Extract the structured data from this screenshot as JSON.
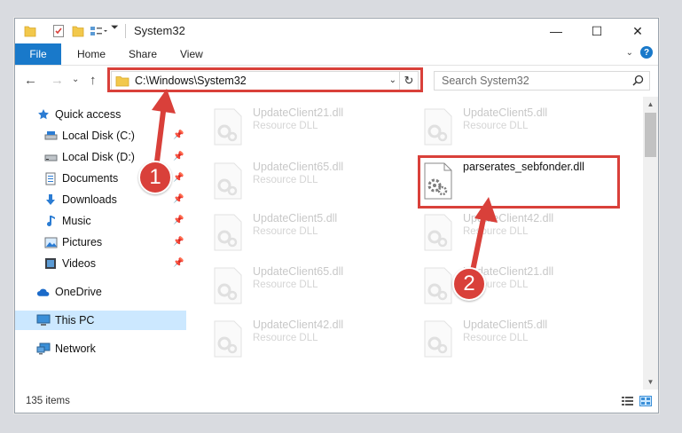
{
  "window": {
    "title": "System32",
    "minimize_glyph": "—",
    "maximize_glyph": "☐",
    "close_glyph": "✕"
  },
  "ribbon": {
    "tabs": [
      "File",
      "Home",
      "Share",
      "View"
    ],
    "expand_glyph": "⌄",
    "help_glyph": "?"
  },
  "nav": {
    "back_glyph": "←",
    "forward_glyph": "→",
    "recent_glyph": "⌄",
    "up_glyph": "↑",
    "address": "C:\\Windows\\System32",
    "address_dropdown_glyph": "⌄",
    "refresh_glyph": "↻",
    "search_placeholder": "Search System32"
  },
  "sidebar": {
    "items": [
      {
        "label": "Quick access",
        "icon": "star-icon",
        "pinned": false
      },
      {
        "label": "Local Disk (C:)",
        "icon": "drive-icon",
        "pinned": true
      },
      {
        "label": "Local Disk (D:)",
        "icon": "drive-icon",
        "pinned": true
      },
      {
        "label": "Documents",
        "icon": "documents-icon",
        "pinned": true
      },
      {
        "label": "Downloads",
        "icon": "download-icon",
        "pinned": true
      },
      {
        "label": "Music",
        "icon": "music-icon",
        "pinned": true
      },
      {
        "label": "Pictures",
        "icon": "pictures-icon",
        "pinned": true
      },
      {
        "label": "Videos",
        "icon": "videos-icon",
        "pinned": true
      },
      {
        "label": "OneDrive",
        "icon": "cloud-icon",
        "pinned": false
      },
      {
        "label": "This PC",
        "icon": "computer-icon",
        "pinned": false,
        "selected": true
      },
      {
        "label": "Network",
        "icon": "network-icon",
        "pinned": false
      }
    ]
  },
  "files": [
    {
      "name": "UpdateClient21.dll",
      "type": "Resource DLL"
    },
    {
      "name": "UpdateClient5.dll",
      "type": "Resource DLL"
    },
    {
      "name": "UpdateClient65.dll",
      "type": "Resource DLL"
    },
    {
      "name": "parserates_sebfonder.dll",
      "type": ""
    },
    {
      "name": "UpdateClient5.dll",
      "type": "Resource DLL"
    },
    {
      "name": "UpdateClient42.dll",
      "type": "Resource DLL"
    },
    {
      "name": "UpdateClient65.dll",
      "type": "Resource DLL"
    },
    {
      "name": "UpdateClient21.dll",
      "type": "Resource DLL"
    },
    {
      "name": "UpdateClient42.dll",
      "type": "Resource DLL"
    },
    {
      "name": "UpdateClient5.dll",
      "type": "Resource DLL"
    }
  ],
  "status": {
    "item_count": "135 items"
  },
  "callouts": {
    "step1": "1",
    "step2": "2"
  },
  "colors": {
    "accent": "#1979ca",
    "highlight": "#d9403a",
    "selected": "#cce8ff"
  }
}
